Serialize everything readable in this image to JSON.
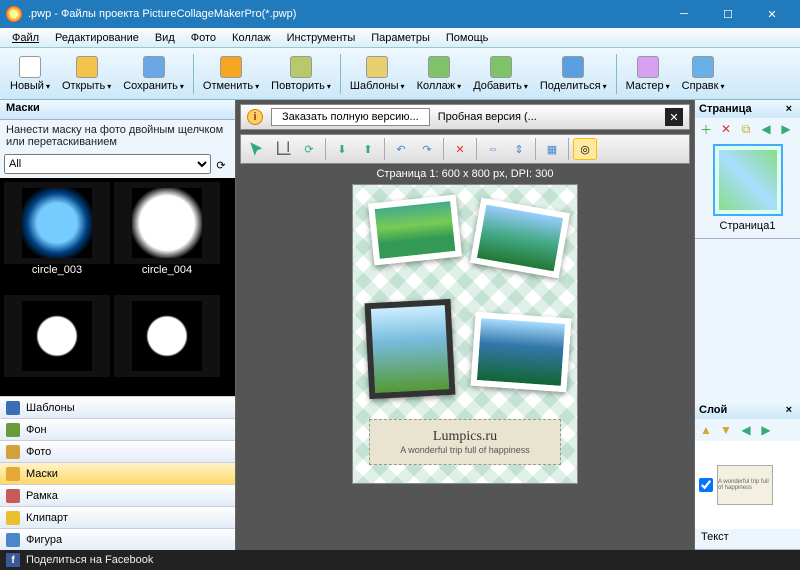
{
  "title": ".pwp - Файлы проекта PictureCollageMakerPro(*.pwp)",
  "menu": [
    "Файл",
    "Редактирование",
    "Вид",
    "Фото",
    "Коллаж",
    "Инструменты",
    "Параметры",
    "Помощь"
  ],
  "toolbar": [
    {
      "label": "Новый",
      "color": "#fff"
    },
    {
      "label": "Открыть",
      "color": "#f6c34a"
    },
    {
      "label": "Сохранить",
      "color": "#6aa6e8"
    },
    {
      "sep": true
    },
    {
      "label": "Отменить",
      "color": "#f6a623"
    },
    {
      "label": "Повторить",
      "color": "#b8c96b"
    },
    {
      "sep": true
    },
    {
      "label": "Шаблоны",
      "color": "#e8d070"
    },
    {
      "label": "Коллаж",
      "color": "#7ec26a"
    },
    {
      "label": "Добавить",
      "color": "#7ec26a"
    },
    {
      "label": "Поделиться",
      "color": "#5aa0e0"
    },
    {
      "sep": true
    },
    {
      "label": "Мастер",
      "color": "#d8a0f0"
    },
    {
      "label": "Справк",
      "color": "#6ab0e8"
    }
  ],
  "masks": {
    "title": "Маски",
    "hint": "Нанести маску на фото двойным щелчком или перетаскиванием",
    "filter": "All",
    "items": [
      "circle_003",
      "circle_004",
      "",
      ""
    ]
  },
  "nav": [
    {
      "label": "Шаблоны",
      "color": "#3b6fb5"
    },
    {
      "label": "Фон",
      "color": "#6a9b3a"
    },
    {
      "label": "Фото",
      "color": "#d4a038"
    },
    {
      "label": "Маски",
      "color": "#e8a838",
      "active": true
    },
    {
      "label": "Рамка",
      "color": "#c85a5a"
    },
    {
      "label": "Клипарт",
      "color": "#e8c030"
    },
    {
      "label": "Фигура",
      "color": "#4a86c8"
    }
  ],
  "info": {
    "btn": "Заказать полную версию...",
    "trial": "Пробная версия (..."
  },
  "pageInfo": "Страница 1: 600 x 800 px, DPI: 300",
  "banner": {
    "t1": "Lumpics.ru",
    "t2": "A wonderful trip full of happiness"
  },
  "pagePanel": {
    "title": "Страница",
    "thumb": "Страница1"
  },
  "layerPanel": {
    "title": "Слой",
    "item": "Текст",
    "thumbText": "A wonderful trip full of happiness"
  },
  "status": {
    "fb": "Поделиться на Facebook"
  }
}
